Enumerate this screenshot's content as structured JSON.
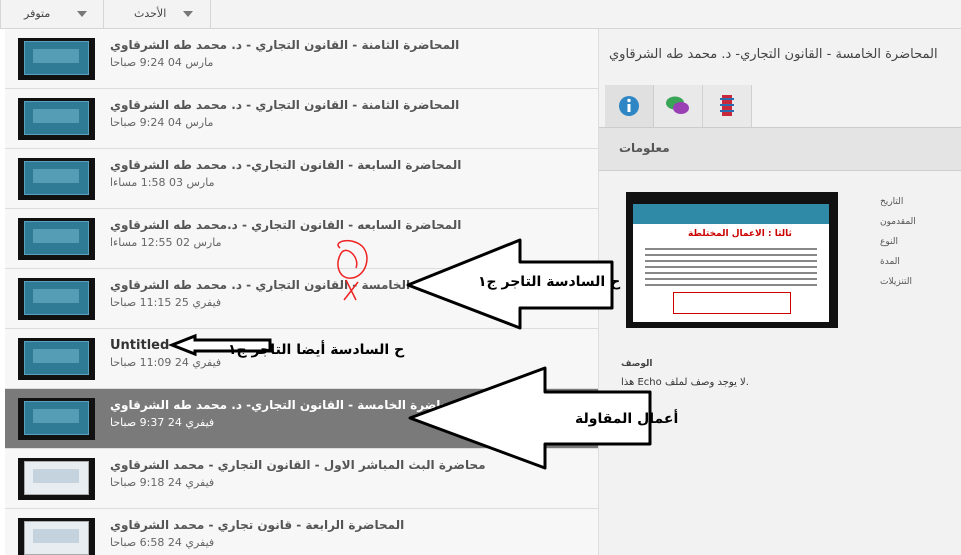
{
  "filters": [
    {
      "label": "متوفر"
    },
    {
      "label": "الأحدث"
    }
  ],
  "list": [
    {
      "title": "المحاضرة الثامنة - القانون التجاري - د. محمد طه الشرقاوي",
      "date": "مارس 04 9:24 صباحا"
    },
    {
      "title": "المحاضرة الثامنة - القانون التجاري - د. محمد طه الشرقاوي",
      "date": "مارس 04 9:24 صباحا"
    },
    {
      "title": "المحاضرة السابعة - القانون التجاري- د. محمد طه الشرقاوي",
      "date": "مارس 03 1:58 مساءا"
    },
    {
      "title": "المحاضرة السابعه - القانون التجاري - د.محمد طه الشرقاوي",
      "date": "مارس 02 12:55 مساءا"
    },
    {
      "title": "المحاضرة الخامسة - القانون التجاري - د. محمد طه الشرقاوي",
      "date": "فيفري 25 11:15 صباحا"
    },
    {
      "title": "Untitled",
      "date": "فيفري 24 11:09 صباحا"
    },
    {
      "title": "المحاضرة الخامسة - القانون التجاري- د. محمد طه الشرقاوي",
      "date": "فيفري 24 9:37 صباحا"
    },
    {
      "title": "محاضرة البث المباشر الاول - القانون التجاري - محمد الشرقاوي",
      "date": "فيفري 24 9:18 صباحا"
    },
    {
      "title": "المحاضرة الرابعة - قانون تجاري - محمد الشرقاوي",
      "date": "فيفري 24 6:58 صباحا"
    }
  ],
  "panel": {
    "title": "المحاضرة الخامسة - القانون التجاري- د. محمد طه الشرقاوي",
    "tabs": [
      {
        "icon": "info-icon"
      },
      {
        "icon": "chat-bubbles-icon"
      },
      {
        "icon": "bookmark-icon"
      }
    ],
    "section_title": "معلومات",
    "meta_labels": [
      "التاريخ",
      "المقدمون",
      "النوع",
      "المدة",
      "التنزيلات"
    ],
    "slide_heading": "ثالثا : الاعمال المختلطة",
    "description_label": "الوصف",
    "description_text": "هذا Echo لا يوجد وصف لملف."
  },
  "annotations": {
    "a1": "ح السادسة التاجر ج١",
    "a2": "ح السادسة أيضا التاجر ج١",
    "a3": "أعمال المقاولة"
  },
  "colors": {
    "selected_row": "#7a7a7a",
    "accent_blue": "#2f8aa8",
    "arrow_fill": "#ffffff"
  }
}
